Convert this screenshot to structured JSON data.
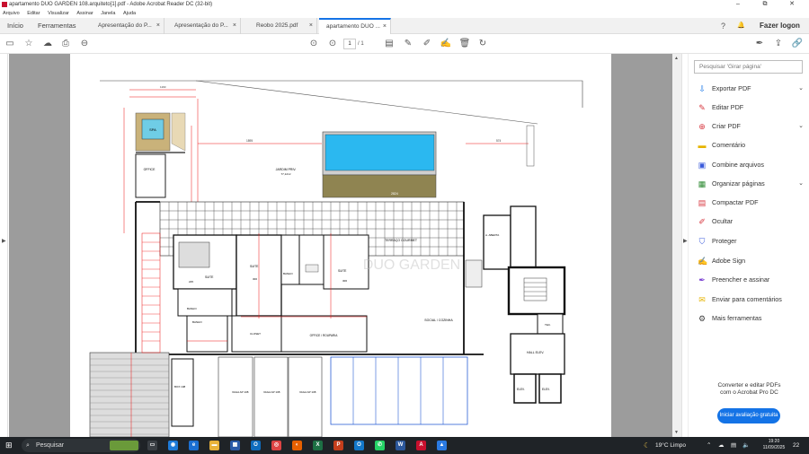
{
  "window": {
    "title": "apartamento DUO GARDEN 108.arquiteto[1].pdf - Adobe Acrobat Reader DC (32-bit)",
    "minimize": "–",
    "maximize": "⧉",
    "close": "✕"
  },
  "menu": [
    "Arquivo",
    "Editar",
    "Visualizar",
    "Assinar",
    "Janela",
    "Ajuda"
  ],
  "tabs": {
    "home": "Início",
    "tools": "Ferramentas",
    "docs": [
      {
        "label": "Apresentação do P...",
        "close": "×"
      },
      {
        "label": "Apresentação do P...",
        "close": "×"
      },
      {
        "label": "Reobo 2025.pdf",
        "close": "×"
      },
      {
        "label": "apartamento DUO ...",
        "close": "×"
      }
    ],
    "help": "?",
    "bell": "🔔",
    "signin": "Fazer logon"
  },
  "pagenav": {
    "current": "1",
    "total": "/ 1"
  },
  "rightpane": {
    "search_placeholder": "Pesquisar 'Girar página'",
    "tools": [
      {
        "label": "Exportar PDF",
        "icon": "export-pdf-icon",
        "color": "#1473e6",
        "chev": "⌄"
      },
      {
        "label": "Editar PDF",
        "icon": "edit-pdf-icon",
        "color": "#d7373f",
        "chev": ""
      },
      {
        "label": "Criar PDF",
        "icon": "create-pdf-icon",
        "color": "#d7373f",
        "chev": "⌄"
      },
      {
        "label": "Comentário",
        "icon": "comment-icon",
        "color": "#e6b400",
        "chev": ""
      },
      {
        "label": "Combine arquivos",
        "icon": "combine-icon",
        "color": "#3b5bdb",
        "chev": ""
      },
      {
        "label": "Organizar páginas",
        "icon": "organize-icon",
        "color": "#2d8a32",
        "chev": "⌄"
      },
      {
        "label": "Compactar PDF",
        "icon": "compress-icon",
        "color": "#d7373f",
        "chev": ""
      },
      {
        "label": "Ocultar",
        "icon": "redact-icon",
        "color": "#d7373f",
        "chev": ""
      },
      {
        "label": "Proteger",
        "icon": "protect-icon",
        "color": "#3b5bdb",
        "chev": ""
      },
      {
        "label": "Adobe Sign",
        "icon": "sign-icon",
        "color": "#7a3fd1",
        "chev": ""
      },
      {
        "label": "Preencher e assinar",
        "icon": "fill-sign-icon",
        "color": "#7a3fd1",
        "chev": ""
      },
      {
        "label": "Enviar para comentários",
        "icon": "send-comments-icon",
        "color": "#e6b400",
        "chev": ""
      },
      {
        "label": "Mais ferramentas",
        "icon": "more-tools-icon",
        "color": "#444444",
        "chev": ""
      }
    ],
    "promo_line1": "Converter e editar PDFs",
    "promo_line2": "com o Acrobat Pro DC",
    "trial_button": "Iniciar avaliação gratuita"
  },
  "plan": {
    "spa": "SPA",
    "office_small": "OFFICE",
    "jardim": "JARDIM PRIV.",
    "jardim_area": "77,12m²",
    "terraco": "TERRAÇO GOURMET",
    "suite1": "SUITE",
    "suite2": "SUITE",
    "banho1": "BANHO",
    "banho2": "BANHO",
    "banho3": "BANHO",
    "closet": "CLOSET",
    "office": "OFFICE / ROUPARIA",
    "social": "SOCIAL / COZINHA",
    "hall": "HALL ELEV.",
    "elev1": "ELEV.",
    "elev2": "ELEV.",
    "aberta": "A. ABERTA",
    "tec": "TEC.",
    "box": "BOX 108",
    "vaga1": "VAGA AP 108",
    "vaga2": "VAGA AP 108",
    "vaga3": "VAGA AP 108",
    "dim_1": "1895",
    "dim_2": "1160",
    "dim_3": "574",
    "dim_4": "2824",
    "dim_5": "300",
    "dim_6": "306",
    "dim_7": "225",
    "watermark": "DUO GARDEN"
  },
  "taskbar": {
    "start": "⊞",
    "search": "Pesquisar",
    "weather": "19°C  Limpo",
    "time": "19:20",
    "date": "11/09/2025",
    "notif": "22"
  }
}
